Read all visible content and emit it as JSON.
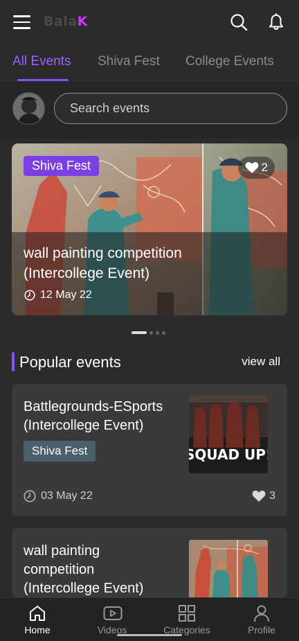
{
  "app": {
    "logo_dim": "Bala",
    "logo_accent": "K",
    "accent_color": "#8a4dff",
    "logo_accent_color": "#c83bf2"
  },
  "icons": {
    "menu": "hamburger-menu-icon",
    "search": "search-icon",
    "notifications": "bell-icon",
    "heart": "heart-icon",
    "clock": "clock-icon"
  },
  "tabs": [
    {
      "label": "All Events",
      "active": true
    },
    {
      "label": "Shiva Fest",
      "active": false
    },
    {
      "label": "College Events",
      "active": false
    }
  ],
  "search": {
    "placeholder": "Search events"
  },
  "featured": {
    "tag": "Shiva Fest",
    "likes": "2",
    "title": "wall painting competition (Intercollege Event)",
    "date": "12 May 22",
    "slide_count": 4,
    "active_slide": 1
  },
  "popular": {
    "title": "Popular events",
    "view_all": "view all",
    "events": [
      {
        "title": "Battlegrounds-ESports (Intercollege Event)",
        "tag": "Shiva Fest",
        "date": "03 May 22",
        "likes": "3",
        "thumb_text": "SQUAD UP!"
      },
      {
        "title": "wall painting competition (Intercollege Event)"
      }
    ]
  },
  "bottom_nav": [
    {
      "label": "Home",
      "icon": "home-icon",
      "active": true
    },
    {
      "label": "Videos",
      "icon": "video-icon",
      "active": false
    },
    {
      "label": "Categories",
      "icon": "grid-icon",
      "active": false
    },
    {
      "label": "Profile",
      "icon": "user-icon",
      "active": false
    }
  ]
}
